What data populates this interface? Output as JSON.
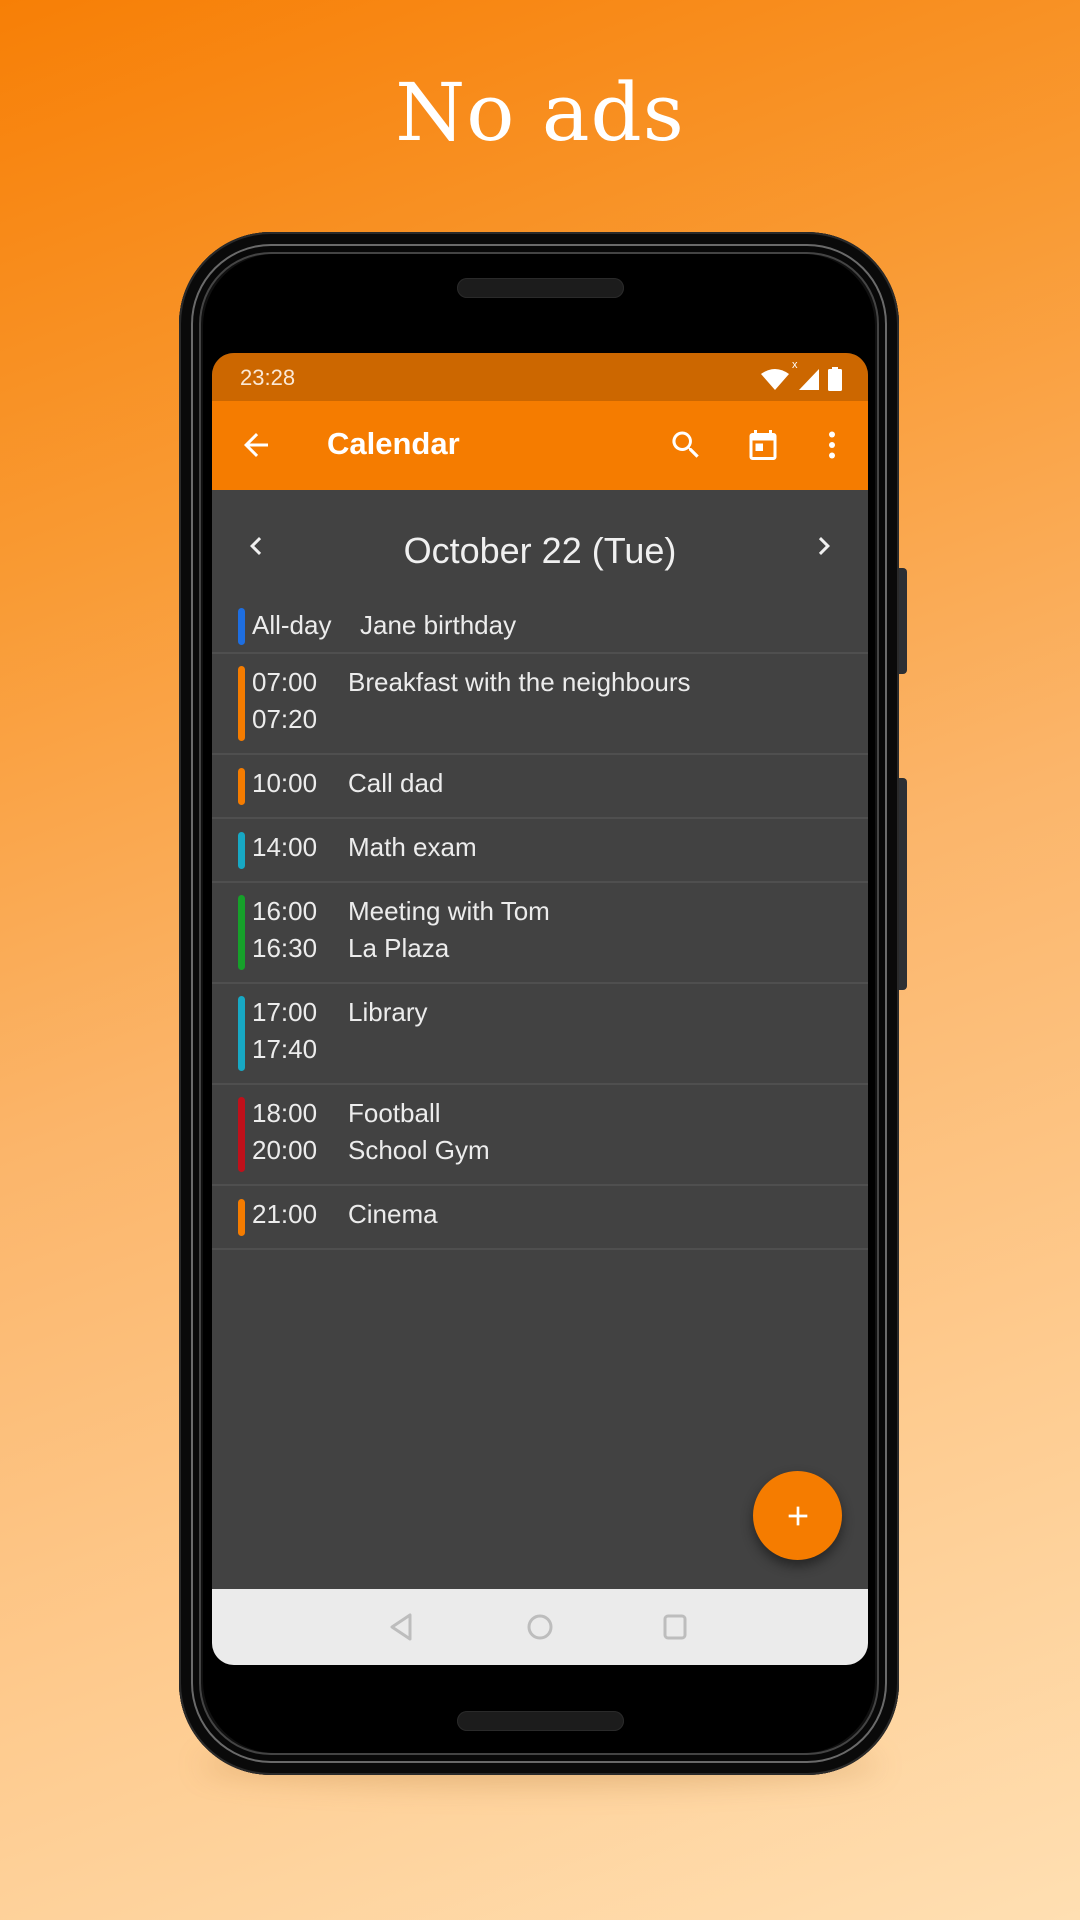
{
  "promo": {
    "headline": "No ads"
  },
  "status_bar": {
    "time": "23:28",
    "icons": [
      "wifi-icon",
      "signal-icon",
      "battery-icon"
    ],
    "signal_badge": "x"
  },
  "toolbar": {
    "back_icon": "arrow-back-icon",
    "title": "Calendar",
    "actions": [
      "search-icon",
      "calendar-today-icon",
      "more-vert-icon"
    ]
  },
  "date_nav": {
    "prev_icon": "chevron-left-icon",
    "date_label": "October 22 (Tue)",
    "next_icon": "chevron-right-icon"
  },
  "events": [
    {
      "start": "All-day",
      "end": "",
      "title": "Jane birthday",
      "location": "",
      "color": "#1e6ee0"
    },
    {
      "start": "07:00",
      "end": "07:20",
      "title": "Breakfast with the neighbours",
      "location": "",
      "color": "#f57c00"
    },
    {
      "start": "10:00",
      "end": "",
      "title": "Call dad",
      "location": "",
      "color": "#f57c00"
    },
    {
      "start": "14:00",
      "end": "",
      "title": "Math exam",
      "location": "",
      "color": "#17a8c4"
    },
    {
      "start": "16:00",
      "end": "16:30",
      "title": "Meeting with Tom",
      "location": "La Plaza",
      "color": "#16a02a"
    },
    {
      "start": "17:00",
      "end": "17:40",
      "title": "Library",
      "location": "",
      "color": "#17a8c4"
    },
    {
      "start": "18:00",
      "end": "20:00",
      "title": "Football",
      "location": "School Gym",
      "color": "#c0101a"
    },
    {
      "start": "21:00",
      "end": "",
      "title": "Cinema",
      "location": "",
      "color": "#f57c00"
    }
  ],
  "fab": {
    "icon": "add-icon"
  },
  "nav_bar": {
    "buttons": [
      "nav-back-icon",
      "nav-home-icon",
      "nav-recents-icon"
    ]
  },
  "colors": {
    "accent": "#f57c00",
    "status_bar": "#cc6700",
    "background": "#424242",
    "nav_bar": "#ebebeb"
  }
}
